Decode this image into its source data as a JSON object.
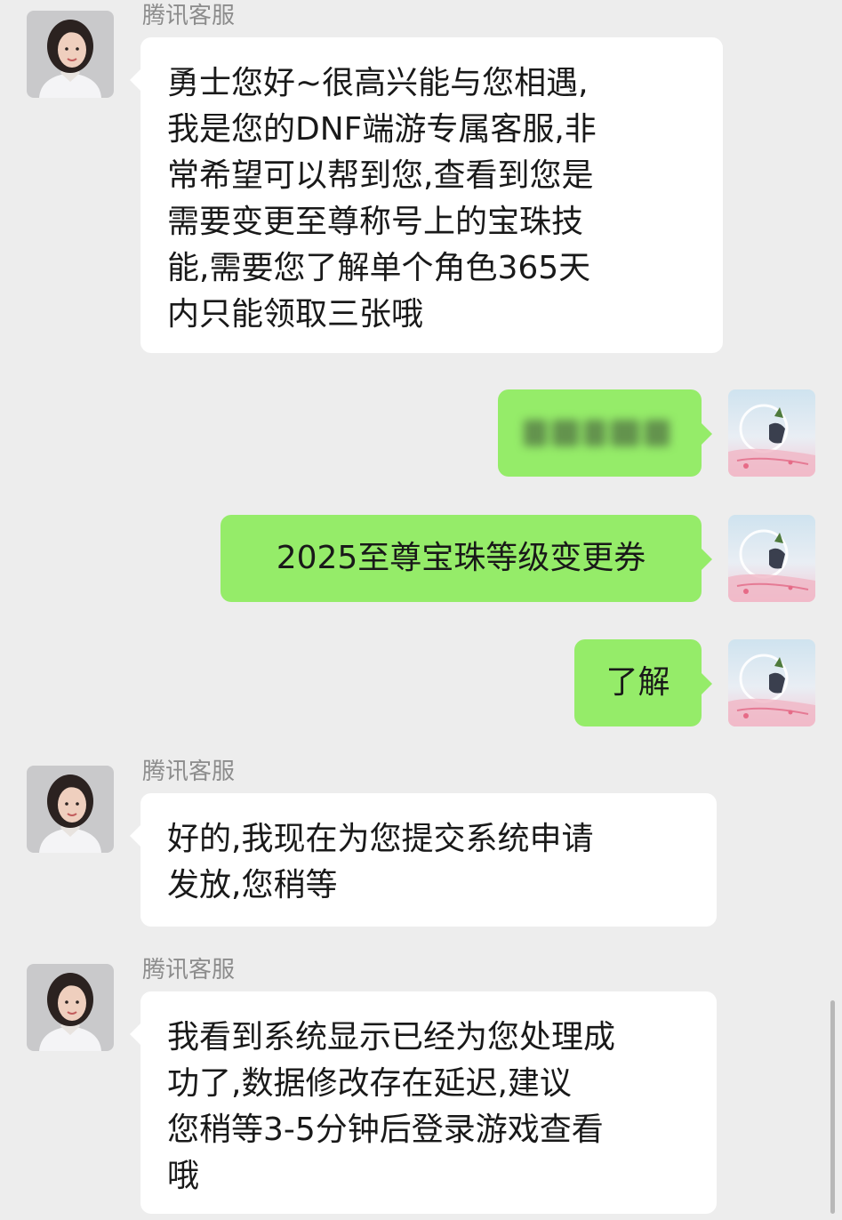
{
  "messages": [
    {
      "sender": "腾讯客服",
      "lines": [
        "勇士您好~很高兴能与您相遇,",
        "我是您的DNF端游专属客服,非",
        "常希望可以帮到您,查看到您是",
        "需要变更至尊称号上的宝珠技",
        "能,需要您了解单个角色365天",
        "内只能领取三张哦"
      ]
    },
    {
      "text": "2025至尊宝珠等级变更券"
    },
    {
      "text": "了解"
    },
    {
      "sender": "腾讯客服",
      "lines": [
        "好的,我现在为您提交系统申请",
        "发放,您稍等"
      ]
    },
    {
      "sender": "腾讯客服",
      "lines": [
        "我看到系统显示已经为您处理成",
        "功了,数据修改存在延迟,建议",
        "您稍等3-5分钟后登录游戏查看",
        "哦"
      ]
    }
  ],
  "colors": {
    "background": "#ededed",
    "incoming_bubble": "#ffffff",
    "outgoing_bubble": "#95ec69",
    "sender_name": "#8c8c8c"
  },
  "icons": {
    "agent_avatar": "agent-avatar-icon",
    "user_avatar": "user-avatar-icon"
  }
}
